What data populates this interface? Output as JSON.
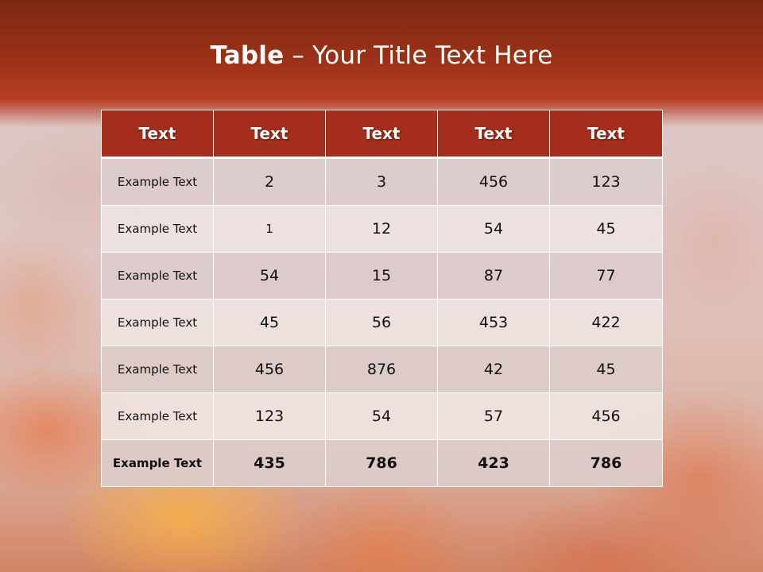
{
  "slide": {
    "title_bold": "Table",
    "title_dash": " – ",
    "title_rest": "Your Title Text Here"
  },
  "table": {
    "headers": [
      "Text",
      "Text",
      "Text",
      "Text",
      "Text"
    ],
    "rows": [
      [
        "Example Text",
        "2",
        "3",
        "456",
        "123"
      ],
      [
        "Example Text",
        "1",
        "12",
        "54",
        "45"
      ],
      [
        "Example Text",
        "54",
        "15",
        "87",
        "77"
      ],
      [
        "Example Text",
        "45",
        "56",
        "453",
        "422"
      ],
      [
        "Example Text",
        "456",
        "876",
        "42",
        "45"
      ],
      [
        "Example Text",
        "123",
        "54",
        "57",
        "456"
      ],
      [
        "Example Text",
        "435",
        "786",
        "423",
        "786"
      ]
    ]
  },
  "colors": {
    "header_fill": "#a42e1b",
    "title_band_top": "#7d2814",
    "title_band_bottom": "#b63d22",
    "title_text": "#ffffff",
    "row_odd": "#dccccc",
    "row_even": "#eee4e2"
  }
}
